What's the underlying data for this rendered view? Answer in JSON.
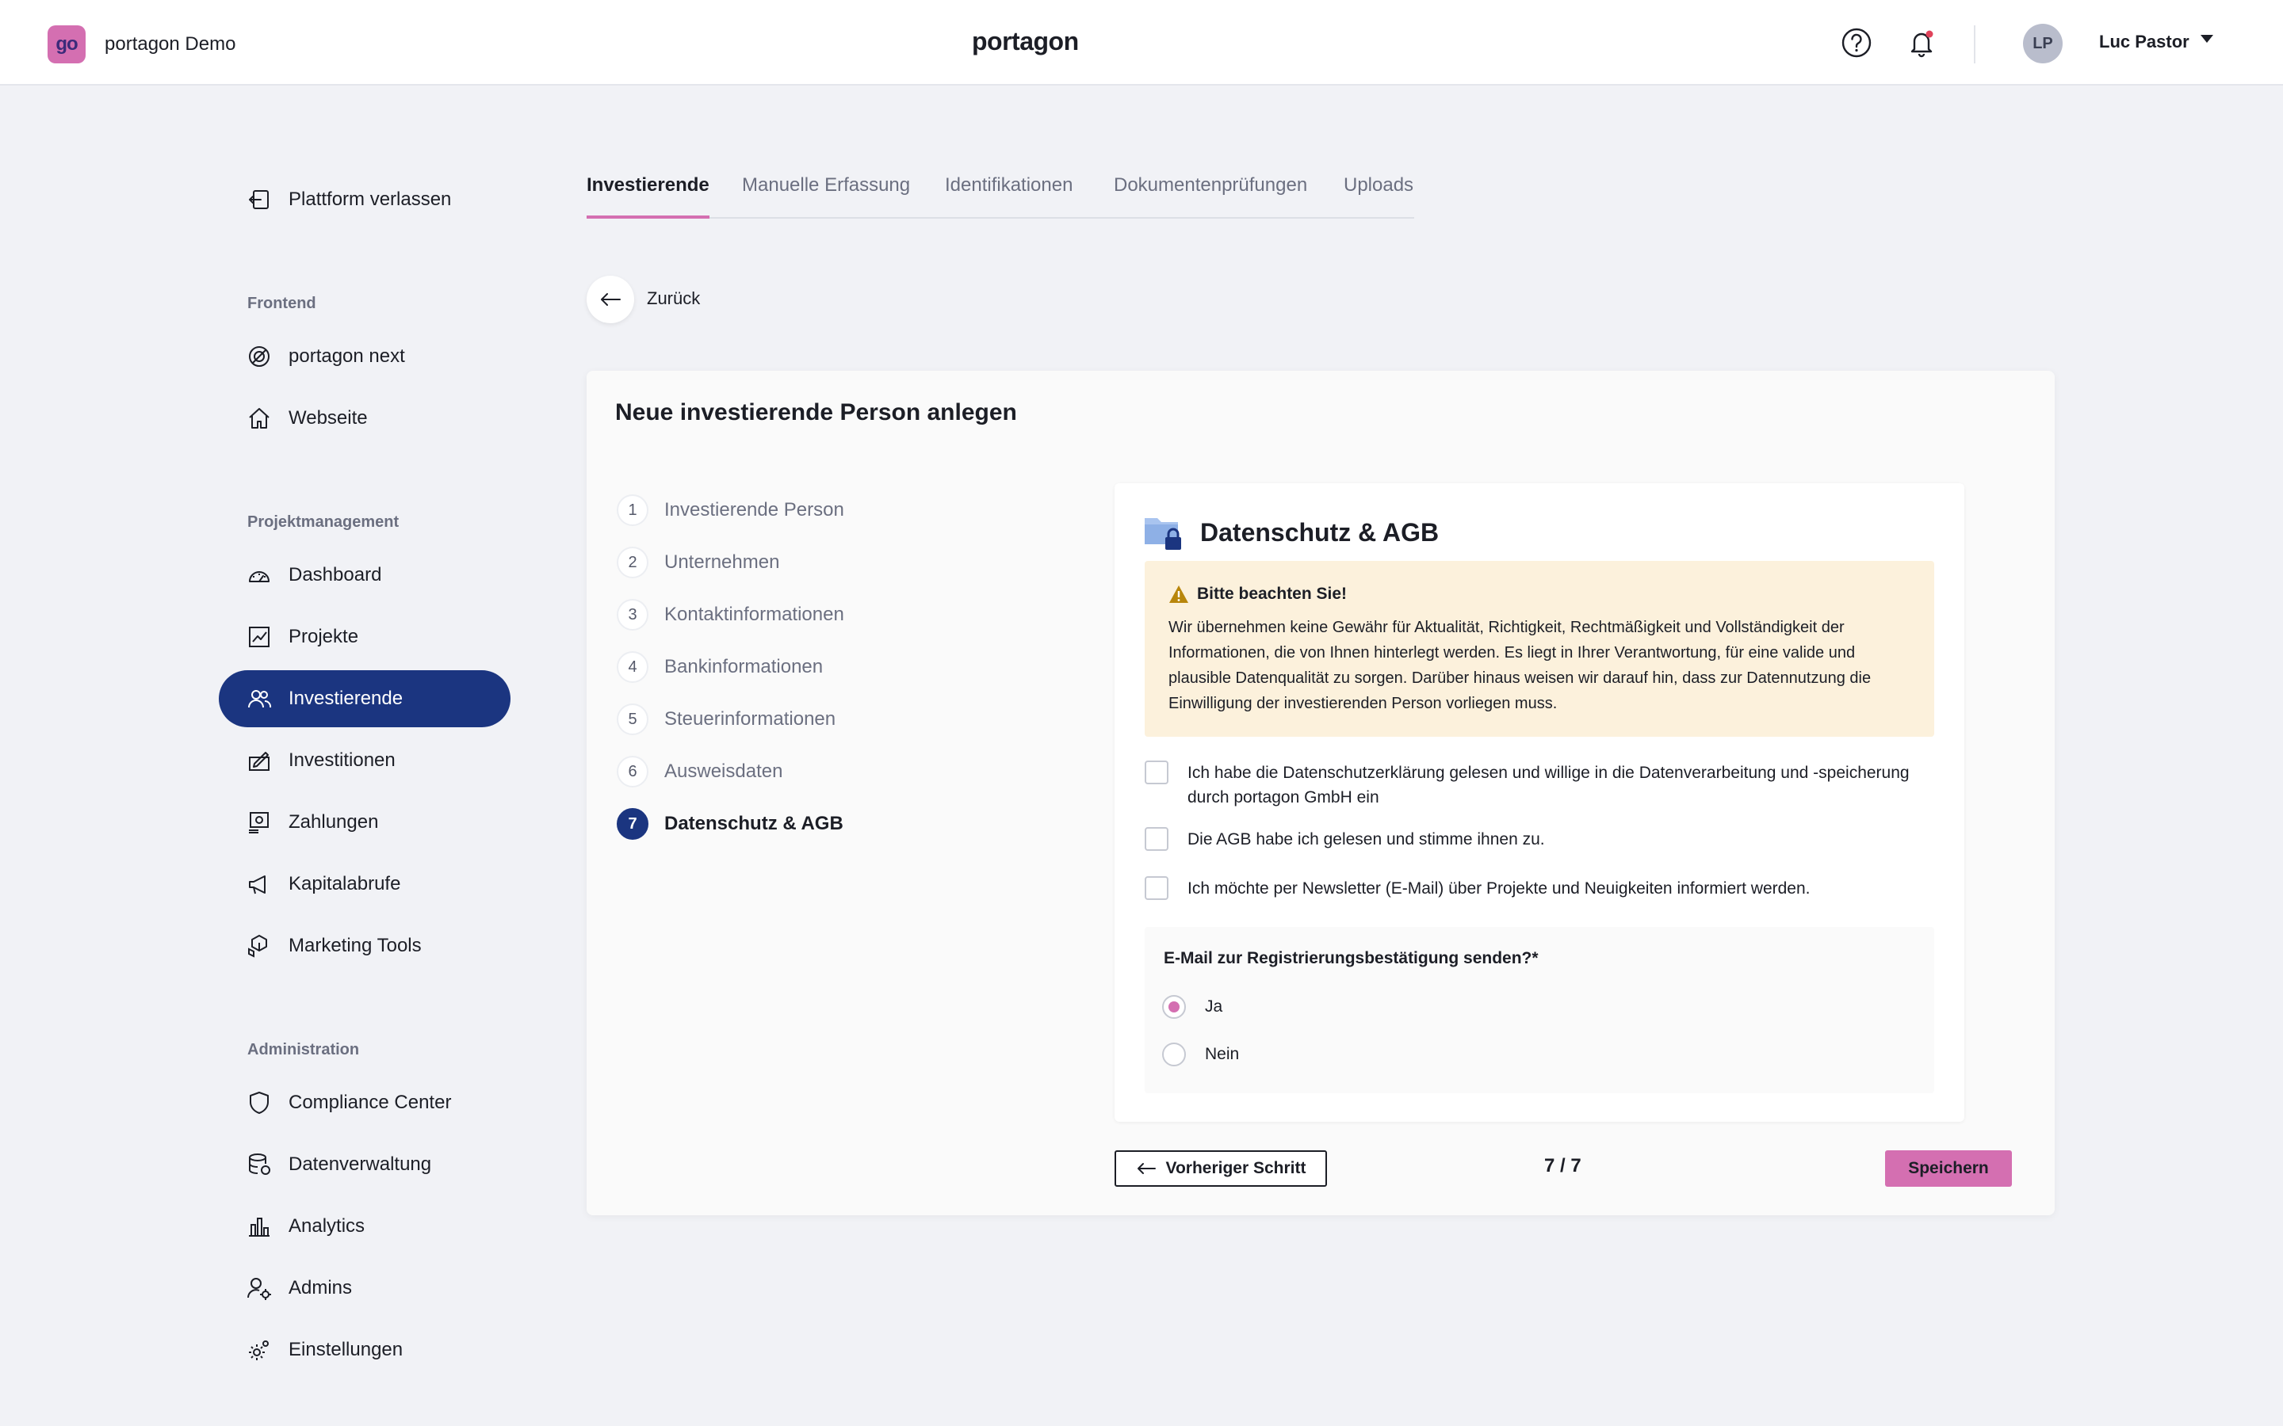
{
  "header": {
    "org_logo_text": "go",
    "org_name": "portagon Demo",
    "brand": "portagon",
    "user_initials": "LP",
    "user_name": "Luc Pastor"
  },
  "sidebar": {
    "exit_label": "Plattform verlassen",
    "sections": {
      "frontend": "Frontend",
      "project": "Projektmanagement",
      "admin": "Administration"
    },
    "items": {
      "portagon_next": "portagon next",
      "website": "Webseite",
      "dashboard": "Dashboard",
      "projects": "Projekte",
      "investors": "Investierende",
      "investments": "Investitionen",
      "payments": "Zahlungen",
      "capital_calls": "Kapitalabrufe",
      "marketing": "Marketing Tools",
      "compliance": "Compliance Center",
      "data": "Datenverwaltung",
      "analytics": "Analytics",
      "admins": "Admins",
      "settings": "Einstellungen"
    }
  },
  "tabs": {
    "investors": "Investierende",
    "manual": "Manuelle Erfassung",
    "identifications": "Identifikationen",
    "documents": "Dokumentenprüfungen",
    "uploads": "Uploads"
  },
  "back_label": "Zurück",
  "form": {
    "title": "Neue investierende Person anlegen",
    "steps": [
      {
        "num": "1",
        "label": "Investierende Person"
      },
      {
        "num": "2",
        "label": "Unternehmen"
      },
      {
        "num": "3",
        "label": "Kontaktinformationen"
      },
      {
        "num": "4",
        "label": "Bankinformationen"
      },
      {
        "num": "5",
        "label": "Steuerinformationen"
      },
      {
        "num": "6",
        "label": "Ausweisdaten"
      },
      {
        "num": "7",
        "label": "Datenschutz & AGB"
      }
    ],
    "panel_title": "Datenschutz & AGB",
    "notice_title": "Bitte beachten Sie!",
    "notice_text": "Wir übernehmen keine Gewähr für Aktualität, Richtigkeit, Rechtmäßigkeit und Vollständigkeit der Informationen, die von Ihnen hinterlegt werden. Es liegt in Ihrer Verantwortung, für eine valide und plausible Datenqualität zu sorgen. Darüber hinaus weisen wir darauf hin, dass zur Datennutzung die Einwilligung der investierenden Person vorliegen muss.",
    "checks": {
      "privacy": "Ich habe die Datenschutzerklärung gelesen und willige in die Datenverarbeitung und -speicherung durch portagon GmbH ein",
      "terms": "Die AGB habe ich gelesen und stimme ihnen zu.",
      "newsletter": "Ich möchte per Newsletter (E-Mail) über Projekte und Neuigkeiten informiert werden."
    },
    "radio_question": "E-Mail zur Registrierungsbestätigung senden?*",
    "radio_yes": "Ja",
    "radio_no": "Nein",
    "prev_label": "Vorheriger Schritt",
    "page_count": "7 / 7",
    "save_label": "Speichern"
  },
  "colors": {
    "accent": "#d46fb1",
    "primary": "#1b3580",
    "notice_bg": "#fcf1dc"
  }
}
